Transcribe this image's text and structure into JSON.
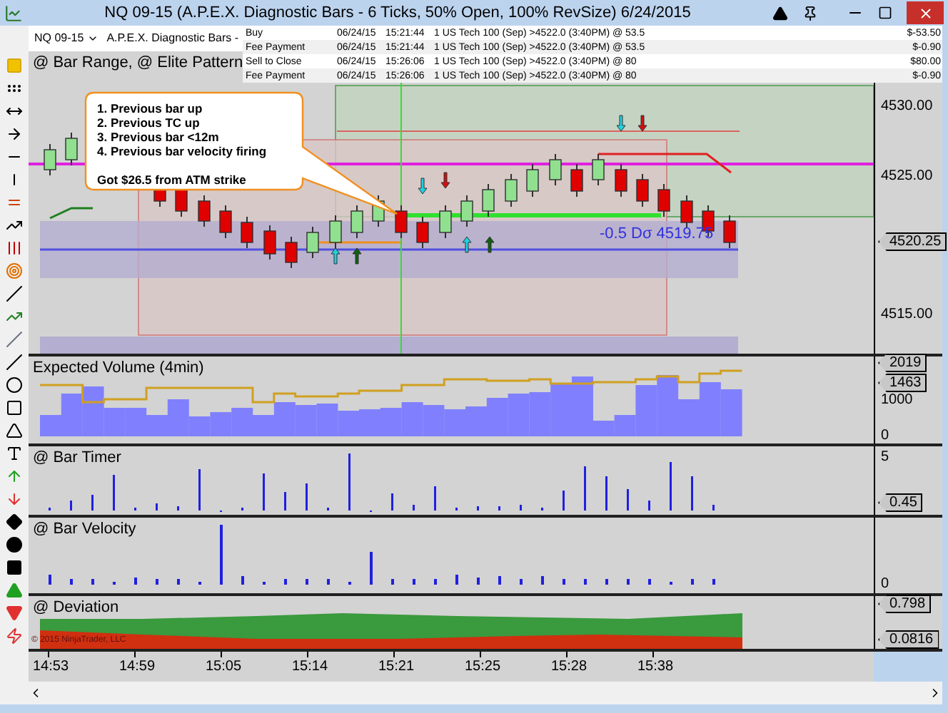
{
  "window": {
    "title": "NQ 09-15 (A.P.E.X. Diagnostic Bars - 6 Ticks, 50% Open, 100% RevSize)  6/24/2015"
  },
  "toolbar": {
    "instrument": "NQ 09-15",
    "bar_type": "A.P.E.X. Diagnostic Bars -"
  },
  "trade_log": [
    {
      "action": "Buy",
      "date": "06/24/15",
      "time": "15:21:44",
      "description": "1 US Tech 100 (Sep) >4522.0 (3:40PM) @ 53.5",
      "amount": "$-53.50"
    },
    {
      "action": "Fee Payment",
      "date": "06/24/15",
      "time": "15:21:44",
      "description": "1 US Tech 100 (Sep) >4522.0 (3:40PM) @ 53.5",
      "amount": "$-0.90"
    },
    {
      "action": "Sell to Close",
      "date": "06/24/15",
      "time": "15:26:06",
      "description": "1 US Tech 100 (Sep) >4522.0 (3:40PM) @ 80",
      "amount": "$80.00"
    },
    {
      "action": "Fee Payment",
      "date": "06/24/15",
      "time": "15:26:06",
      "description": "1 US Tech 100 (Sep) >4522.0 (3:40PM) @ 80",
      "amount": "$-0.90"
    }
  ],
  "price_panel": {
    "label": "@ Bar Range, @ Elite Pattern",
    "callout": {
      "lines": [
        "1. Previous bar up",
        "2. Previous TC up",
        "3. Previous bar <12m",
        "4. Previous bar velocity firing"
      ],
      "note": "Got $26.5 from ATM strike"
    },
    "band_label": "-0.5 Dσ 4519.75",
    "axis": [
      {
        "text": "4530.00",
        "kind": "tick"
      },
      {
        "text": "4525.00",
        "kind": "tick"
      },
      {
        "text": "4520.25",
        "kind": "tag"
      },
      {
        "text": "4515.00",
        "kind": "tick"
      }
    ]
  },
  "volume_panel": {
    "label": "Expected Volume (4min)",
    "axis": [
      {
        "text": "2019",
        "kind": "tag"
      },
      {
        "text": "1463",
        "kind": "tag"
      },
      {
        "text": "1000",
        "kind": "tick"
      },
      {
        "text": "0",
        "kind": "tick"
      }
    ]
  },
  "timer_panel": {
    "label": "@ Bar Timer",
    "axis": [
      {
        "text": "5",
        "kind": "tick"
      },
      {
        "text": "0.45",
        "kind": "tag"
      }
    ]
  },
  "velocity_panel": {
    "label": "@ Bar Velocity",
    "axis": [
      {
        "text": "0",
        "kind": "tick"
      }
    ]
  },
  "deviation_panel": {
    "label": "@ Deviation",
    "copyright": "© 2015 NinjaTrader, LLC",
    "axis": [
      {
        "text": "0.798",
        "kind": "tag"
      },
      {
        "text": "0.0816",
        "kind": "tag"
      }
    ]
  },
  "time_axis": [
    "14:53",
    "14:59",
    "15:05",
    "15:14",
    "15:21",
    "15:25",
    "15:28",
    "15:38"
  ]
}
